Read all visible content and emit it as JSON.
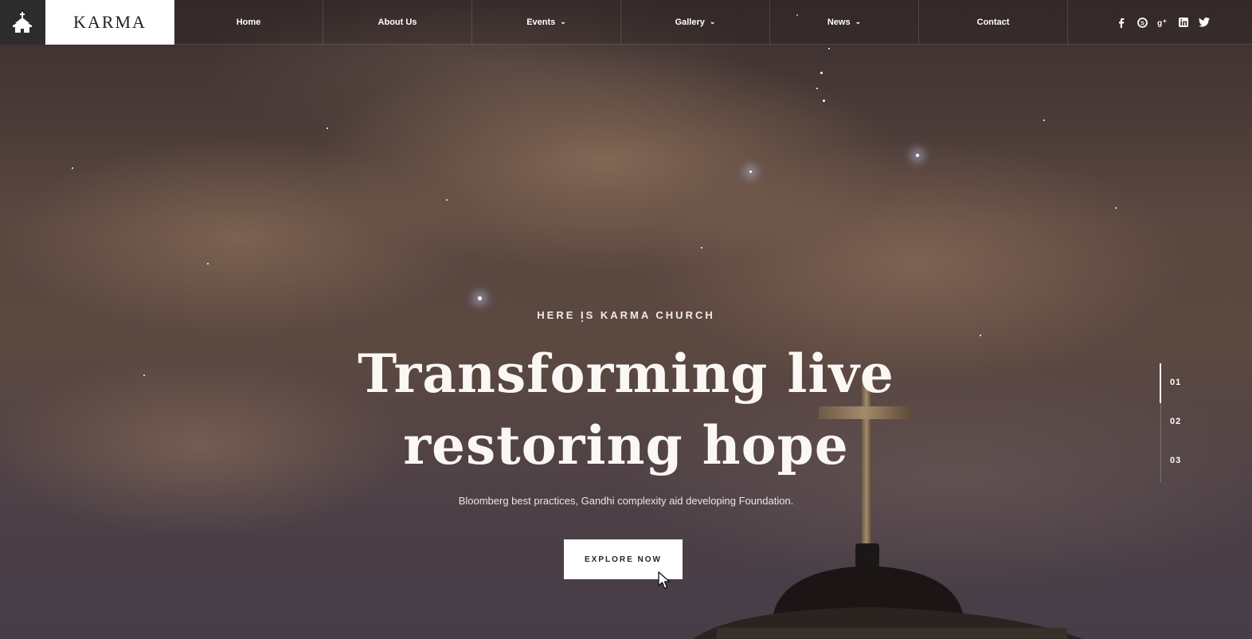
{
  "brand": {
    "logo_text": "KARMA",
    "home_icon": "church-icon"
  },
  "nav": {
    "items": [
      {
        "label": "Home",
        "has_dropdown": false
      },
      {
        "label": "About Us",
        "has_dropdown": false
      },
      {
        "label": "Events",
        "has_dropdown": true
      },
      {
        "label": "Gallery",
        "has_dropdown": true
      },
      {
        "label": "News",
        "has_dropdown": true
      },
      {
        "label": "Contact",
        "has_dropdown": false
      }
    ],
    "social": [
      {
        "icon": "facebook-icon",
        "glyph": "f"
      },
      {
        "icon": "skype-icon",
        "glyph": "S"
      },
      {
        "icon": "google-plus-icon",
        "glyph": "g+"
      },
      {
        "icon": "linkedin-icon",
        "glyph": "in"
      },
      {
        "icon": "twitter-icon",
        "glyph": "t"
      }
    ]
  },
  "hero": {
    "eyebrow": "HERE IS KARMA CHURCH",
    "headline_line1": "Transforming live",
    "headline_line2": "restoring hope",
    "subtext": "Bloomberg best practices, Gandhi complexity aid developing Foundation.",
    "cta_label": "EXPLORE NOW"
  },
  "slider": {
    "pages": [
      "01",
      "02",
      "03"
    ],
    "active_index": 0
  },
  "colors": {
    "nav_icon_bg": "#2c2c2c",
    "logo_bg": "#ffffff",
    "cta_bg": "#ffffff",
    "text": "#ffffff"
  }
}
